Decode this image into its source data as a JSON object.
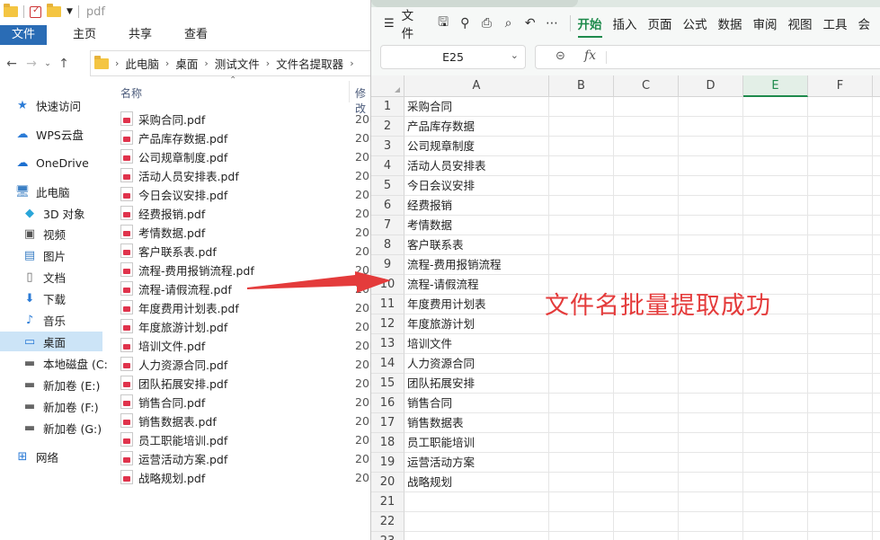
{
  "explorer": {
    "window_title": "pdf",
    "ribbon_tabs": [
      "文件",
      "主页",
      "共享",
      "查看"
    ],
    "breadcrumb": [
      "此电脑",
      "桌面",
      "测试文件",
      "文件名提取器"
    ],
    "nav_items": [
      {
        "label": "快速访问",
        "icon": "star-icon"
      },
      {
        "label": "WPS云盘",
        "icon": "cloud-icon"
      },
      {
        "label": "OneDrive",
        "icon": "onedrive-icon"
      },
      {
        "label": "此电脑",
        "icon": "computer-icon"
      },
      {
        "label": "3D 对象",
        "icon": "cube-icon"
      },
      {
        "label": "视频",
        "icon": "video-icon"
      },
      {
        "label": "图片",
        "icon": "picture-icon"
      },
      {
        "label": "文档",
        "icon": "document-icon"
      },
      {
        "label": "下载",
        "icon": "download-icon"
      },
      {
        "label": "音乐",
        "icon": "music-icon"
      },
      {
        "label": "桌面",
        "icon": "desktop-icon"
      },
      {
        "label": "本地磁盘 (C:",
        "icon": "drive-icon"
      },
      {
        "label": "新加卷 (E:)",
        "icon": "drive-icon"
      },
      {
        "label": "新加卷 (F:)",
        "icon": "drive-icon"
      },
      {
        "label": "新加卷 (G:)",
        "icon": "drive-icon"
      },
      {
        "label": "网络",
        "icon": "network-icon"
      }
    ],
    "selected_nav": "桌面",
    "column_name": "名称",
    "column_modified": "修改",
    "files": [
      "采购合同.pdf",
      "产品库存数据.pdf",
      "公司规章制度.pdf",
      "活动人员安排表.pdf",
      "今日会议安排.pdf",
      "经费报销.pdf",
      "考情数据.pdf",
      "客户联系表.pdf",
      "流程-费用报销流程.pdf",
      "流程-请假流程.pdf",
      "年度费用计划表.pdf",
      "年度旅游计划.pdf",
      "培训文件.pdf",
      "人力资源合同.pdf",
      "团队拓展安排.pdf",
      "销售合同.pdf",
      "销售数据表.pdf",
      "员工职能培训.pdf",
      "运营活动方案.pdf",
      "战略规划.pdf"
    ],
    "date_prefix": "20"
  },
  "sheet": {
    "menu_file": "文件",
    "menus": [
      "开始",
      "插入",
      "页面",
      "公式",
      "数据",
      "审阅",
      "视图",
      "工具",
      "会"
    ],
    "active_menu": "开始",
    "name_box": "E25",
    "fx_label": "fx",
    "columns": [
      "A",
      "B",
      "C",
      "D",
      "E",
      "F"
    ],
    "selected_column": "E",
    "row_numbers": [
      "1",
      "2",
      "3",
      "4",
      "5",
      "6",
      "7",
      "8",
      "9",
      "10",
      "11",
      "12",
      "13",
      "14",
      "15",
      "16",
      "17",
      "18",
      "19",
      "20",
      "21",
      "22",
      "23"
    ],
    "column_a": [
      "采购合同",
      "产品库存数据",
      "公司规章制度",
      "活动人员安排表",
      "今日会议安排",
      "经费报销",
      "考情数据",
      "客户联系表",
      "流程-费用报销流程",
      "流程-请假流程",
      "年度费用计划表",
      "年度旅游计划",
      "培训文件",
      "人力资源合同",
      "团队拓展安排",
      "销售合同",
      "销售数据表",
      "员工职能培训",
      "运营活动方案",
      "战略规划"
    ]
  },
  "annotation": {
    "text": "文件名批量提取成功",
    "color": "#e43b3b"
  }
}
